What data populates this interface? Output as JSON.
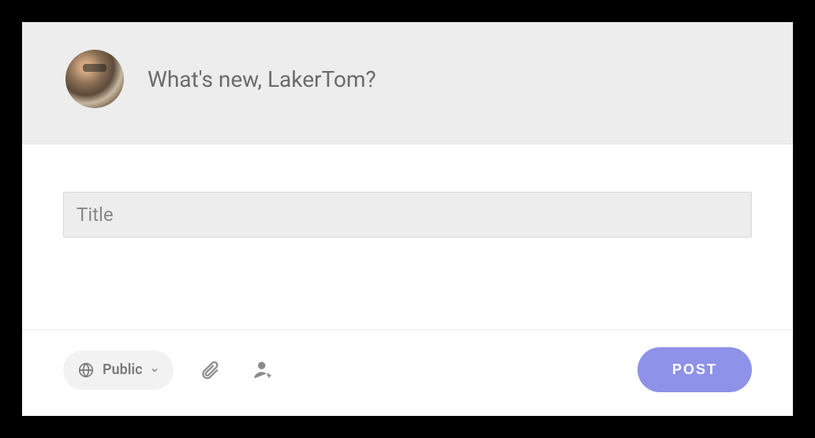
{
  "header": {
    "prompt": "What's new, LakerTom?"
  },
  "body": {
    "title_placeholder": "Title",
    "title_value": ""
  },
  "footer": {
    "visibility_label": "Public",
    "post_label": "POST"
  }
}
